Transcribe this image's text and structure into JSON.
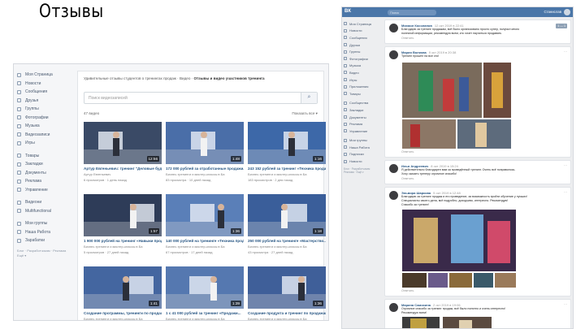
{
  "slide": {
    "title": "Отзывы"
  },
  "left": {
    "sidebar": [
      {
        "label": "Моя Страница"
      },
      {
        "label": "Новости"
      },
      {
        "label": "Сообщения"
      },
      {
        "label": "Друзья"
      },
      {
        "label": "Группы"
      },
      {
        "label": "Фотографии"
      },
      {
        "label": "Музыка"
      },
      {
        "label": "Видеозаписи"
      },
      {
        "label": "Игры"
      },
      {
        "gap": true
      },
      {
        "label": "Товары"
      },
      {
        "label": "Закладки"
      },
      {
        "label": "Документы"
      },
      {
        "label": "Реклама"
      },
      {
        "label": "Управление"
      },
      {
        "gap": true
      },
      {
        "label": "Видеони"
      },
      {
        "label": "Multifunctional"
      },
      {
        "gap": true
      },
      {
        "label": "Мои группы"
      },
      {
        "label": "Наша Работа"
      },
      {
        "label": "Зарабатки"
      }
    ],
    "sidebar_footer": [
      "Блог · Разработчикам · Реклама",
      "Ещё ▾"
    ],
    "breadcrumb": {
      "text": "Удивительные отзывы студентов о тренингах продаж · Видео · ",
      "bold": "Отзывы и видео участников тренинга"
    },
    "search_placeholder": "Поиск видеозаписей",
    "count": "47 видео",
    "sort": "Показать все ▾",
    "videos": [
      {
        "title": "Артур Евгеньевич: тренинг \"Деловые буд...",
        "meta": "Артур Евгеньевич",
        "stats": "6 просмотров · 1 день назад",
        "dur": "12:56",
        "bg": "#3a4a66"
      },
      {
        "title": "172 000 рублей за отработанные продажи...",
        "meta": "Бизнес-тренинги и мастер-классы в Ба",
        "stats": "83 просмотра · 10 дней назад",
        "dur": "1:48",
        "bg": "#4a6ea8"
      },
      {
        "title": "243 152 рублей за тренинг «Техника продаж...",
        "meta": "Бизнес-тренинги и мастер-классы в Ба",
        "stats": "183 просмотров · 2 дня назад",
        "dur": "1:16",
        "bg": "#3d68a8"
      },
      {
        "title": "1 900 000 рублей на тренинг «Навыки продаж»",
        "meta": "Бизнес-тренинги и мастер-классы в Ба",
        "stats": "5 просмотров · 27 дней назад",
        "dur": "1:57",
        "bg": "#2e3c58"
      },
      {
        "title": "140 000 рублей на тренинге «Техника прод...",
        "meta": "Бизнес-тренинги и мастер-классы в Ба",
        "stats": "67 просмотров · 17 дней назад",
        "dur": "1:36",
        "bg": "#5a7fb8"
      },
      {
        "title": "250 000 рублей на тренинге «Мастерство...",
        "meta": "Бизнес-тренинги и мастер-классы в Ба",
        "stats": "43 просмотра · 27 дней назад",
        "dur": "1:18",
        "bg": "#3a5e9a"
      },
      {
        "title": "Создание программы, тренинги по продажам...",
        "meta": "Бизнес-тренинги и мастер-классы в Ба",
        "stats": "",
        "dur": "1:41",
        "bg": "#4466a0"
      },
      {
        "title": "1 с 41 000 рублей за тренинг «Продажи...",
        "meta": "Бизнес-тренинги и мастер-классы в Ба",
        "stats": "",
        "dur": "1:39",
        "bg": "#5578b0"
      },
      {
        "title": "Создание продукта и тренинг по продажам...",
        "meta": "Бизнес-тренинги и мастер-классы в Ба",
        "stats": "",
        "dur": "1:36",
        "bg": "#3f5f99"
      }
    ]
  },
  "right": {
    "topbar": {
      "logo": "ВК",
      "search": "Поиск",
      "user": "Станислав"
    },
    "sidebar": [
      {
        "label": "Моя Страница"
      },
      {
        "label": "Новости"
      },
      {
        "label": "Сообщения"
      },
      {
        "label": "Друзья"
      },
      {
        "label": "Группы"
      },
      {
        "label": "Фотографии"
      },
      {
        "label": "Музыка"
      },
      {
        "label": "Видео"
      },
      {
        "label": "Игры"
      },
      {
        "label": "Приложения"
      },
      {
        "label": "Товары"
      },
      {
        "gap": true
      },
      {
        "label": "Сообщества"
      },
      {
        "label": "Закладки"
      },
      {
        "label": "Документы"
      },
      {
        "label": "Реклама"
      },
      {
        "label": "Управление"
      },
      {
        "gap": true
      },
      {
        "label": "Мои группы"
      },
      {
        "label": "Наша Работа"
      },
      {
        "label": "Подписки"
      },
      {
        "label": "Новости"
      }
    ],
    "sidebar_footer": [
      "Блог · Разработчикам",
      "Реклама · Ещё ▾"
    ],
    "posts": [
      {
        "name": "Михаил Косолапов",
        "time": "12 окт 2019 в 22:41",
        "text": [
          "Благодарю за тренинг продажам, всё было организовано просто супер, получил много",
          "полезной информации, рекомендую всем, кто хочет научиться продавать"
        ],
        "link": "Ответить",
        "badge": "1 — 1"
      },
      {
        "name": "Мария Волкова",
        "time": "9 окт 2019 в 20:38",
        "text": [
          "Тренинг прошёл на все сто!"
        ],
        "link": "Ответить"
      },
      {
        "name": "Илья Андреевич",
        "time": "8 окт 2019 в 15:24",
        "text": [
          "Я действительно благодарен вам за проведённый тренинг. Очень всё понравилось.",
          "Хочу сказать тренеру огромное спасибо!"
        ],
        "link": "Ответить"
      },
      {
        "name": "Эльвира Шаркова",
        "time": "5 окт 2019 в 12:48",
        "text": [
          "Благодарю за тренинг продаж и его проведение, за возможность пройти обучение у лучших!",
          "Специалисты своего дела, всё подробно, доходчиво, интересно. Рекомендую!",
          "Спасибо за тренинг!"
        ],
        "link": "Ответить"
      },
      {
        "name": "Марина Самохина",
        "time": "2 окт 2019 в 19:06",
        "text": [
          "Огромное спасибо за тренинг продаж, всё было понятно и очень интересно!",
          "Рекомендую всем!"
        ],
        "link": ""
      }
    ]
  }
}
